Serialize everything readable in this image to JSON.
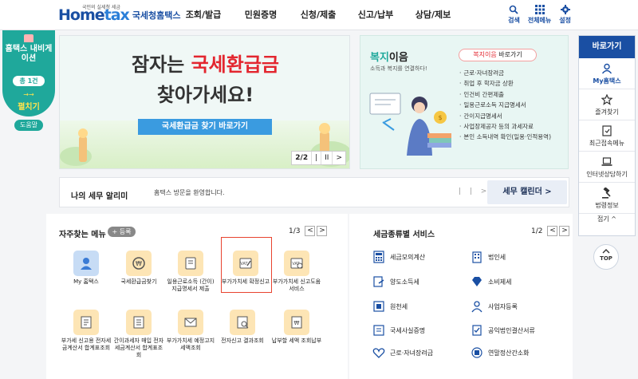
{
  "header": {
    "logo_small": "국민의 실세청 세금",
    "logo_home": "Home",
    "logo_tax": "tax",
    "logo_org": "국세청홈택스",
    "menu": [
      "조회/발급",
      "민원증명",
      "신청/제출",
      "신고/납부",
      "상담/제보"
    ],
    "util": [
      {
        "label": "검색",
        "icon": "search-icon"
      },
      {
        "label": "전체메뉴",
        "icon": "grid-icon"
      },
      {
        "label": "설정",
        "icon": "gear-icon"
      }
    ]
  },
  "navigator": {
    "title": "홈택스 내비게이션",
    "count": "총 1건",
    "arrows": "→→",
    "open": "펼치기",
    "help": "도움말"
  },
  "hero": {
    "line1_pre": "잠자는 ",
    "line1_red": "국세환급금",
    "line2": "찾아가세요!",
    "button": "국세환급금 찾기 바로가기",
    "page": "2/2",
    "prev": "|",
    "pause": "II",
    "next": ">"
  },
  "welfare": {
    "title_pre": "복지",
    "title_post": "이음",
    "subtitle": "소득과 복지를 연결하다!",
    "button_red": "복지이음",
    "button_post": " 바로가기",
    "items": [
      "근로·자녀장려금",
      "취업 후 학자금 상환",
      "인건비 간편제출",
      "일용근로소득 지급명세서",
      "간이지급명세서",
      "사업장제공자 등의 과세자료",
      "본인 소득내역 확인(일용·인적용역)"
    ]
  },
  "quick": {
    "header": "바로가기",
    "items": [
      {
        "label": "My홈택스",
        "icon": "user-icon"
      },
      {
        "label": "즐겨찾기",
        "icon": "star-icon"
      },
      {
        "label": "최근접속메뉴",
        "icon": "recent-icon"
      },
      {
        "label": "인터넷상담하기",
        "icon": "laptop-icon"
      },
      {
        "label": "법령정보",
        "icon": "gavel-icon"
      }
    ],
    "collapse": "접기 ^",
    "top": "TOP"
  },
  "notice": {
    "title": "나의 세무 알리미",
    "message": "홈택스 방문을 환영합니다.",
    "controls": "| | >",
    "calendar": "세무 캘린더 >"
  },
  "frequent": {
    "title": "자주찾는 메뉴",
    "add": "+ 등록",
    "page": "1/3",
    "items": [
      {
        "label": "My 홈택스",
        "icon": "user-icon"
      },
      {
        "label": "국세환급금찾기",
        "icon": "refund-icon"
      },
      {
        "label": "일용근로소득 (간이)지급명세서 제출",
        "icon": "document-icon"
      },
      {
        "label": "부가가치세 확정신고",
        "icon": "vat-icon"
      },
      {
        "label": "부가가치세 신고도움 서비스",
        "icon": "vat-help-icon"
      },
      {
        "label": "부가세 신고용 전자세금계산서 합계표조회",
        "icon": "invoice-icon"
      },
      {
        "label": "간이과세자 매입 전자세금계산서 합계표조회",
        "icon": "invoice-search-icon"
      },
      {
        "label": "부가가치세 예정고지 세액조회",
        "icon": "notice-icon"
      },
      {
        "label": "전자신고 결과조회",
        "icon": "result-icon"
      },
      {
        "label": "납부할 세액 조회납부",
        "icon": "payment-icon"
      }
    ]
  },
  "services": {
    "title": "세금종류별 서비스",
    "page": "1/2",
    "items": [
      {
        "label": "세금모의계산",
        "icon": "calculator-icon"
      },
      {
        "label": "법인세",
        "icon": "building-icon"
      },
      {
        "label": "양도소득세",
        "icon": "transfer-icon"
      },
      {
        "label": "소비제세",
        "icon": "diamond-icon"
      },
      {
        "label": "원천세",
        "icon": "withholding-icon"
      },
      {
        "label": "사업자등록",
        "icon": "person-icon"
      },
      {
        "label": "국세사실증명",
        "icon": "certificate-icon"
      },
      {
        "label": "공익법인결산서류",
        "icon": "check-doc-icon"
      },
      {
        "label": "근로·자녀장려금",
        "icon": "heart-icon"
      },
      {
        "label": "연말정산간소화",
        "icon": "calc-doc-icon"
      }
    ]
  }
}
